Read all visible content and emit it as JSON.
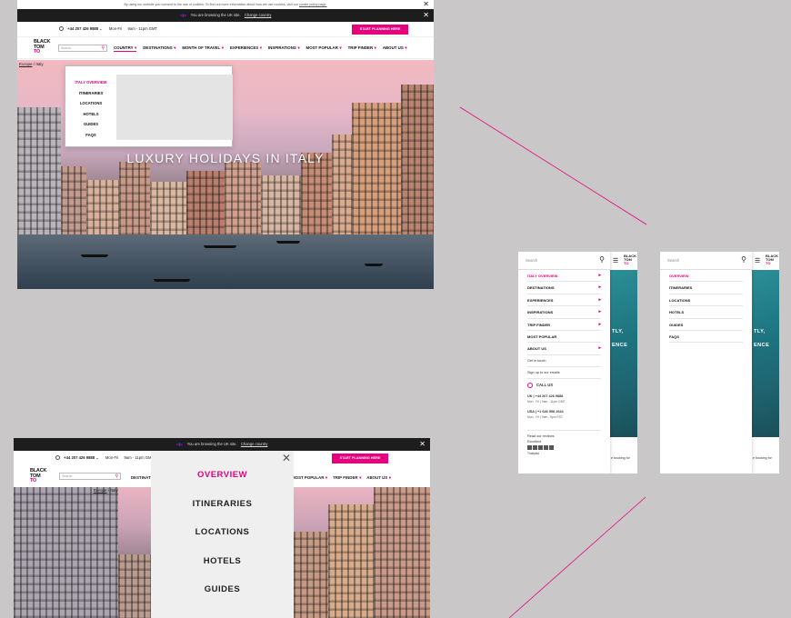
{
  "cookie": {
    "text": "By using our website you consent to the use of cookies. To find out more information about how we use cookies, visit our ",
    "link": "cookie policy page."
  },
  "uk_bar": {
    "text": "You are browsing the UK site.",
    "link": "Change country"
  },
  "close_glyph": "✕",
  "top_bar": {
    "phone": "+44 207 426 9888",
    "hours_days": "Mon-Fri",
    "hours_time": "9am - 11pm GMT",
    "cta": "START PLANNING HERE"
  },
  "logo": {
    "line1": "BLACK",
    "line2": "TOM",
    "line3": "TO",
    "accent": "#e6007e"
  },
  "search": {
    "placeholder": "Search"
  },
  "nav": [
    "COUNTRY",
    "DESTINATIONS",
    "MONTH OF TRAVEL",
    "EXPERIENCES",
    "INSPIRATIONS",
    "MOST POPULAR",
    "TRIP FINDER",
    "ABOUT US"
  ],
  "nav_b_left": "DESTINATIONS",
  "nav_b_right": [
    "MOST POPULAR",
    "TRIP FINDER",
    "ABOUT US"
  ],
  "breadcrumb": {
    "link": "Europe",
    "current": "Italy",
    "sep": "/"
  },
  "hero_title": "LUXURY HOLIDAYS IN ITALY",
  "dropdown": [
    "ITALY OVERVIEW",
    "ITINERARIES",
    "LOCATIONS",
    "HOTELS",
    "GUIDES",
    "FAQS"
  ],
  "overlay": [
    "OVERVIEW",
    "ITINERARIES",
    "LOCATIONS",
    "HOTELS",
    "GUIDES"
  ],
  "mobile1": {
    "search": "Search",
    "items": [
      "ITALY OVERVIEW",
      "DESTINATIONS",
      "EXPERIENCES",
      "INSPIRATIONS",
      "TRIP FINDER",
      "MOST POPULAR",
      "ABOUT US"
    ],
    "get_in_touch": "Get in touch",
    "sign_up": "Sign up to our emails",
    "call_us": "CALL US",
    "uk": "UK | +44 207 426 9888",
    "uk_hours": "Mon - Fri  |  9am - 11pm GMT",
    "usa": "USA | +1 646 558 2644",
    "usa_hours": "Mon - Fri  |  9am - 5pm EST",
    "read_reviews": "Read our reviews",
    "excellent": "Excellent",
    "trustpilot": "Trustpilot",
    "side_text1": "TLY,",
    "side_text2": "ENCE",
    "side_foot": "e booking for"
  },
  "mobile2": {
    "search": "Search",
    "items": [
      "OVERVIEW",
      "ITINERARIES",
      "LOCATIONS",
      "HOTELS",
      "GUIDES",
      "FAQS"
    ],
    "side_text1": "TLY,",
    "side_text2": "ENCE",
    "side_foot": "e booking for"
  },
  "colors": {
    "brand": "#e6007e",
    "dark": "#1d1d1d",
    "bg": "#c9c7c8"
  },
  "icons": {
    "search": "magnifier-icon",
    "close": "close-icon",
    "phone": "phone-icon",
    "chevron": "chevron-down-icon",
    "arrow": "arrow-right-icon",
    "menu": "hamburger-icon"
  }
}
